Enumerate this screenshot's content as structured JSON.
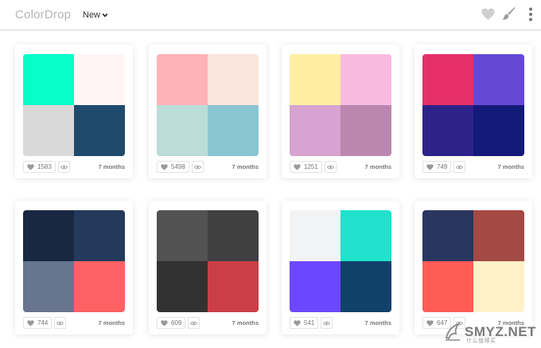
{
  "header": {
    "logo": "ColorDrop",
    "sort_label": "New"
  },
  "cards": [
    {
      "colors": [
        "#08fdc9",
        "#fff5f5",
        "#d9d9d9",
        "#1f4a6b"
      ],
      "likes": "1583",
      "age": "7 months"
    },
    {
      "colors": [
        "#ffb2b7",
        "#fbe4dc",
        "#bbddd8",
        "#8ac5d2"
      ],
      "likes": "5498",
      "age": "7 months"
    },
    {
      "colors": [
        "#feefa4",
        "#f8bbe0",
        "#d7a3d0",
        "#bb87b0"
      ],
      "likes": "1251",
      "age": "7 months"
    },
    {
      "colors": [
        "#e62f68",
        "#6549d5",
        "#2e2289",
        "#141a79"
      ],
      "likes": "749",
      "age": "7 months"
    },
    {
      "colors": [
        "#192841",
        "#25395c",
        "#68758e",
        "#fe6164"
      ],
      "likes": "744",
      "age": "7 months"
    },
    {
      "colors": [
        "#525252",
        "#404040",
        "#323232",
        "#cc3e47"
      ],
      "likes": "609",
      "age": "7 months"
    },
    {
      "colors": [
        "#f2f3f5",
        "#21e2cc",
        "#6c47ff",
        "#114069"
      ],
      "likes": "541",
      "age": "7 months"
    },
    {
      "colors": [
        "#293660",
        "#a44944",
        "#ff5c56",
        "#fff1c7"
      ],
      "likes": "647",
      "age": "7 months"
    }
  ],
  "watermark": {
    "main": "SMYZ.NET",
    "sub": "什么值得买"
  }
}
